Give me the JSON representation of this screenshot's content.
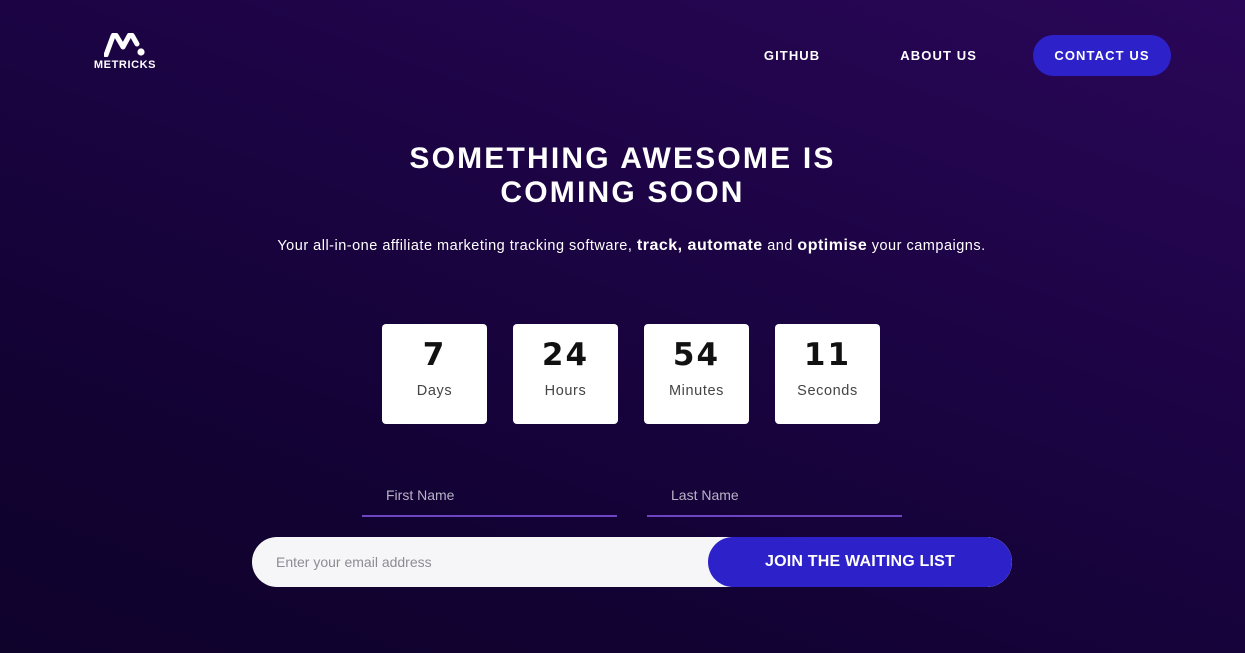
{
  "brand": {
    "name": "METRICKS",
    "logo_icon": "metricks-logo-icon"
  },
  "nav": {
    "github": "GITHUB",
    "about": "ABOUT US",
    "contact": "CONTACT US"
  },
  "hero": {
    "headline_line1": "SOMETHING AWESOME IS",
    "headline_line2": "COMING SOON",
    "sub_part1": "Your all-in-one affiliate marketing tracking software, ",
    "sub_bold1": "track, automate",
    "sub_part2": " and ",
    "sub_bold2": "optimise",
    "sub_part3": " your campaigns."
  },
  "countdown": [
    {
      "value": "7",
      "label": "Days"
    },
    {
      "value": "24",
      "label": "Hours"
    },
    {
      "value": "54",
      "label": "Minutes"
    },
    {
      "value": "11",
      "label": "Seconds"
    }
  ],
  "form": {
    "first_name_placeholder": "First Name",
    "last_name_placeholder": "Last Name",
    "email_placeholder": "Enter your email address",
    "submit_label": "JOIN THE WAITING LIST"
  },
  "colors": {
    "accent": "#2d21c9",
    "underline": "#6b45c2",
    "bg_top": "#2a0658",
    "bg_bottom": "#0f022b"
  }
}
